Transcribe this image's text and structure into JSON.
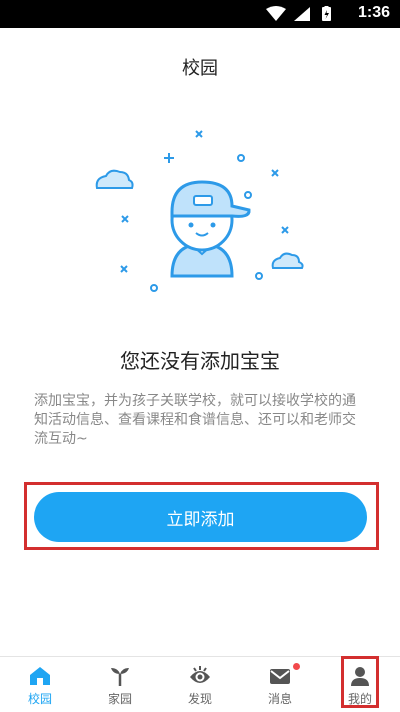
{
  "status_bar": {
    "time": "1:36"
  },
  "header": {
    "title": "校园"
  },
  "empty_state": {
    "title": "您还没有添加宝宝",
    "description": "添加宝宝，并为孩子关联学校，就可以接收学校的通知活动信息、查看课程和食谱信息、还可以和老师交流互动~"
  },
  "actions": {
    "add_label": "立即添加"
  },
  "tabs": [
    {
      "label": "校园",
      "icon": "school-icon",
      "active": true
    },
    {
      "label": "家园",
      "icon": "sprout-icon",
      "active": false
    },
    {
      "label": "发现",
      "icon": "eye-icon",
      "active": false
    },
    {
      "label": "消息",
      "icon": "mail-icon",
      "active": false,
      "badge": true
    },
    {
      "label": "我的",
      "icon": "person-icon",
      "active": false
    }
  ],
  "colors": {
    "accent": "#1ea5f3",
    "highlight": "#d32f2f",
    "badge": "#f2494b"
  }
}
